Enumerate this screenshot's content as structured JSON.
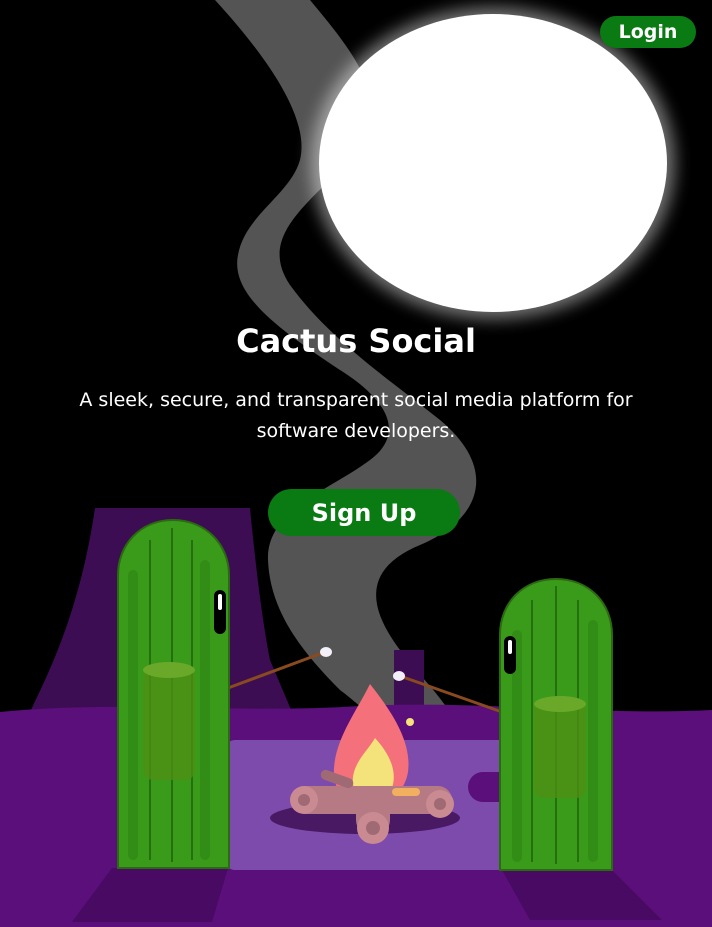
{
  "header": {
    "login_label": "Login"
  },
  "hero": {
    "title": "Cactus Social",
    "tagline": "A sleek, secure, and transparent social media platform for software developers.",
    "signup_label": "Sign Up"
  },
  "colors": {
    "accent_green": "#0a7a12",
    "background": "#000000",
    "ground_purple": "#5a0f7a",
    "cactus_green": "#3a9a1a",
    "moon": "#ffffff",
    "flame": "#f4707a"
  },
  "illustration": {
    "elements": [
      "moon",
      "smoke",
      "butte",
      "cactus-left",
      "cactus-right",
      "campfire",
      "marshmallow-sticks"
    ]
  }
}
